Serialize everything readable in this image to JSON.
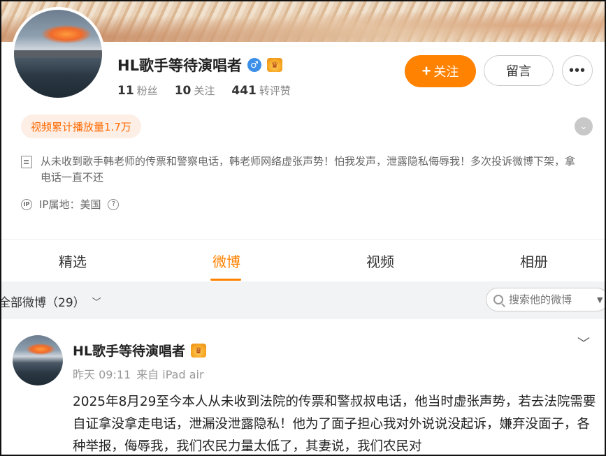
{
  "profile": {
    "name": "HL歌手等待演唱者",
    "gender_icon": "male-icon",
    "badge_icon": "crown-icon",
    "stats": [
      {
        "value": "11",
        "label": "粉丝"
      },
      {
        "value": "10",
        "label": "关注"
      },
      {
        "value": "441",
        "label": "转评赞"
      }
    ],
    "follow_label": "关注",
    "message_label": "留言",
    "more_label": "•••",
    "play_count": "视频累计播放量1.7万",
    "bio": "从未收到歌手韩老师的传票和警察电话，韩老师网络虚张声势！怕我发声，泄露隐私侮辱我！多次投诉微博下架，拿电话一直不还",
    "ip_label": "IP属地：美国",
    "ip_icon_text": "IP"
  },
  "tabs": [
    "精选",
    "微博",
    "视频",
    "相册"
  ],
  "active_tab": "微博",
  "filter": {
    "label": "全部微博（29）",
    "search_placeholder": "搜索他的微博"
  },
  "post": {
    "author": "HL歌手等待演唱者",
    "time": "昨天 09:11",
    "source": "来自 iPad air",
    "text": "2025年8月29至今本人从未收到法院的传票和警叔叔电话，他当时虚张声势，若去法院需要自证拿没拿走电话，泄漏没泄露隐私！他为了面子担心我对外说说没起诉，嫌弃没面子，各种举报，侮辱我，我们农民力量太低了，其妻说，我们农民对"
  },
  "colors": {
    "accent": "#ff8200",
    "play_badge_bg": "#fdeee6",
    "play_badge_text": "#ff6a00",
    "filter_bg": "#f2f3f5"
  }
}
